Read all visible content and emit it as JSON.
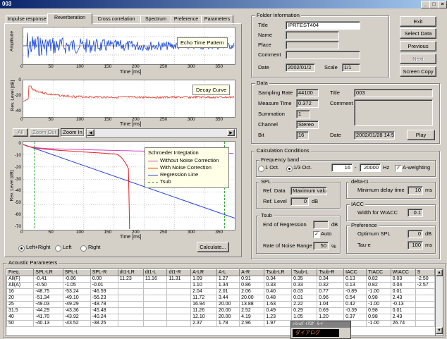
{
  "window": {
    "title": "003"
  },
  "tabs": [
    "Impulse response",
    "Reverberation",
    "Cross correlation",
    "Spectrum",
    "Preference",
    "Parameters"
  ],
  "active_tab": 1,
  "plots": {
    "echo": {
      "label": "Echo Time Pattern",
      "ylabel": "Amplitude",
      "xlabel": "Time [ms]",
      "xticks": [
        "0",
        "50",
        "100",
        "150",
        "200",
        "250",
        "300",
        "350"
      ]
    },
    "decay": {
      "label": "Decay Curve",
      "ylabel": "Rev. Level [dB]",
      "xlabel": "Time [ms]",
      "xticks": [
        "0",
        "50",
        "100",
        "150",
        "200",
        "250",
        "300",
        "350"
      ],
      "yticks": [
        "0",
        "-20",
        "-40"
      ]
    },
    "schroeder": {
      "ylabel": "Rev. Level [dB]",
      "xlabel": "Time [ms]",
      "xticks": [
        "0",
        "50",
        "100",
        "150",
        "200",
        "250",
        "300",
        "350"
      ],
      "yticks": [
        "0",
        "-10",
        "-20",
        "-30",
        "-40",
        "-50",
        "-60",
        "-70"
      ],
      "legend_title": "Schroeder Integtation",
      "legend": [
        "Without Noise Correction",
        "With Noise Correction",
        "Regression Line",
        "Tsub"
      ]
    }
  },
  "zoom_buttons": {
    "all": "All",
    "zoom_out": "Zoom Out",
    "zoom_in": "Zoom In"
  },
  "channel_radios": {
    "lr": "Left+Right",
    "l": "Left",
    "r": "Right"
  },
  "calculate": "Calculate...",
  "folder": {
    "title": "Folder Information",
    "labels": {
      "title": "Title",
      "name": "Name",
      "place": "Place",
      "comment": "Comment",
      "date": "Date",
      "scale": "Scale"
    },
    "values": {
      "title": "IPRTEST404",
      "date": "2002/01/2",
      "scale": "1/1"
    }
  },
  "side_buttons": {
    "exit": "Exit",
    "select": "Select Data",
    "previous": "Previous",
    "next": "Next",
    "screen_copy": "Screen Copy"
  },
  "data": {
    "title": "Data",
    "labels": {
      "sampling_rate": "Sampling Rate",
      "measure_time": "Measure Time",
      "summation": "Summation",
      "channel": "Channel",
      "bit": "Bit",
      "title": "Title",
      "comment": "Comment",
      "date": "Date"
    },
    "values": {
      "sampling_rate": "44100",
      "measure_time": "0.372",
      "summation": "1",
      "channel": "Stereo",
      "bit": "16",
      "title": "003",
      "date": "2002/01/28 14:5"
    },
    "play": "Play"
  },
  "calc": {
    "title": "Calculation Conditions",
    "freq_band": "Frequency band",
    "oct1": "1 Oct.",
    "oct3": "1/3 Oct.",
    "freq_from": "16",
    "freq_to": "20000",
    "hz": "Hz",
    "dash": "-",
    "a_weighting": "A-weighting",
    "spl": {
      "title": "SPL",
      "ref_data_label": "Ref. Data",
      "ref_data": "Maximum value",
      "ref_level_label": "Ref. Level",
      "ref_level": "0",
      "db": "dB"
    },
    "delta": {
      "title": "delta-t1",
      "min_label": "Minimum delay time",
      "min": "10",
      "ms": "ms"
    },
    "iacc": {
      "title": "IACC",
      "width_label": "Width for WIACC",
      "width": "0.1"
    },
    "tsub": {
      "title": "Tsub",
      "end_label": "End of Regression",
      "db": "dB",
      "auto": "Auto",
      "rate_label": "Rate of Noise Range",
      "rate": "50",
      "pct": "%"
    },
    "pref": {
      "title": "Preference",
      "opt_label": "Optimum SPL",
      "opt": "0",
      "db": "dB",
      "tau_label": "Tau-e",
      "tau": "100",
      "ms": "ms"
    }
  },
  "acoustic": {
    "title": "Acoustic Parameters",
    "columns": [
      "Freq.",
      "SPL-LR",
      "SPL-L",
      "SPL-R",
      "dt1-LR",
      "dt1-L",
      "dt1-R",
      "A-LR",
      "A-L",
      "A-R",
      "Tsub-LR",
      "Tsub-L",
      "Tsub-R",
      "IACC",
      "TIACC",
      "WIACC",
      "S"
    ],
    "rows": [
      [
        "All(F)",
        "-0.41",
        "-0.86",
        "0.00",
        "11.23",
        "11.16",
        "11.31",
        "1.09",
        "1.27",
        "0.91",
        "0.34",
        "0.35",
        "0.34",
        "0.13",
        "0.82",
        "0.03",
        "-2.50"
      ],
      [
        "All(A)",
        "-0.50",
        "-1.05",
        "-0.01",
        "",
        "",
        "",
        "1.10",
        "1.34",
        "0.86",
        "0.33",
        "0.33",
        "0.32",
        "0.13",
        "0.82",
        "0.04",
        "-2.57"
      ],
      [
        "16",
        "-48.75",
        "-53.24",
        "-46.59",
        "",
        "",
        "",
        "2.04",
        "2.01",
        "2.06",
        "0.40",
        "0.03",
        "0.77",
        "-0.89",
        "-1.00",
        "0.01",
        ""
      ],
      [
        "20",
        "-51.34",
        "-49.10",
        "-56.23",
        "",
        "",
        "",
        "11.72",
        "3.44",
        "20.00",
        "0.48",
        "0.01",
        "0.96",
        "0.54",
        "0.98",
        "2.43",
        ""
      ],
      [
        "25",
        "-49.03",
        "-49.29",
        "-48.78",
        "",
        "",
        "",
        "16.94",
        "20.00",
        "13.88",
        "1.63",
        "2.22",
        "1.04",
        "0.42",
        "-1.00",
        "-0.13",
        ""
      ],
      [
        "31.5",
        "-44.29",
        "-43.36",
        "-45.48",
        "",
        "",
        "",
        "11.26",
        "20.00",
        "2.52",
        "0.49",
        "0.29",
        "0.69",
        "-0.39",
        "0.98",
        "0.01",
        ""
      ],
      [
        "40",
        "-41.70",
        "-43.92",
        "-40.24",
        "",
        "",
        "",
        "12.10",
        "20.00",
        "4.19",
        "1.23",
        "1.05",
        "1.20",
        "0.37",
        "0.98",
        "2.43",
        ""
      ],
      [
        "50",
        "-40.13",
        "-43.52",
        "-38.25",
        "",
        "",
        "",
        "2.37",
        "1.78",
        "2.96",
        "1.97",
        "0.04",
        "",
        "",
        "-1.00",
        "26.74",
        ""
      ]
    ]
  },
  "ime": {
    "title": "ｼｽﾃﾑﾀﾞｲｱﾛｸﾞ ﾓｰﾄﾞ",
    "label": "ダイアログ"
  }
}
